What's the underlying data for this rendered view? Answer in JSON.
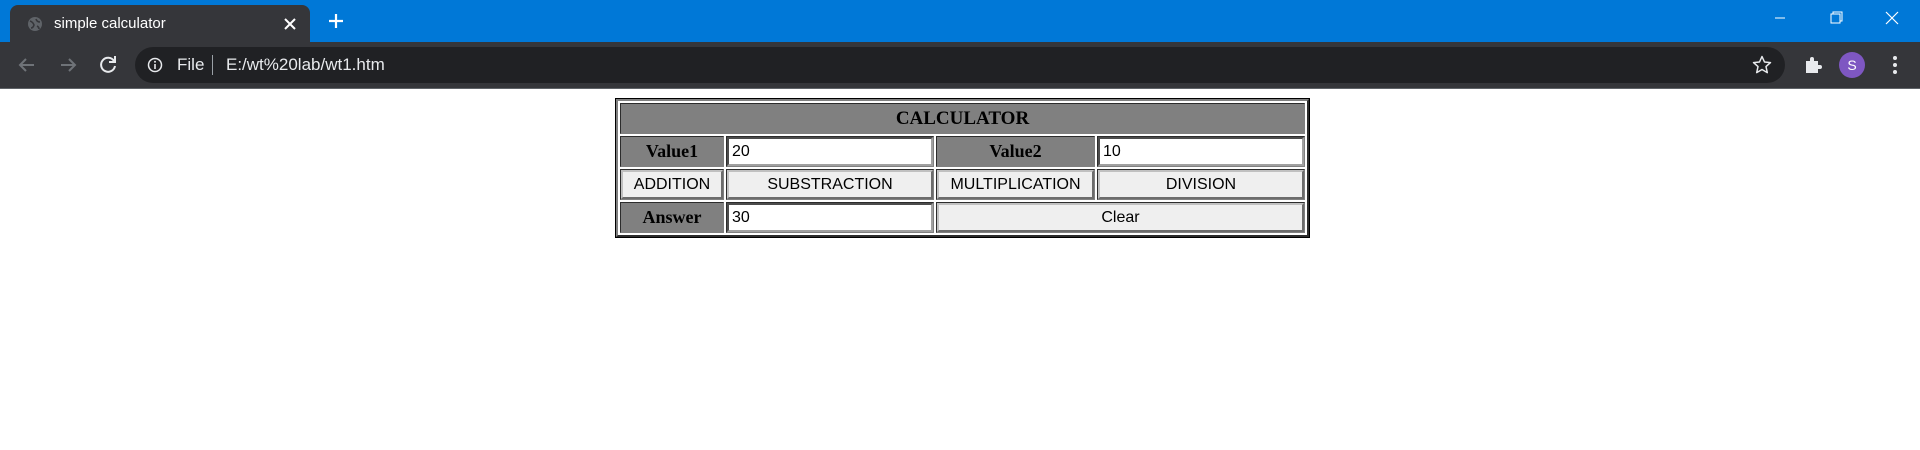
{
  "browser": {
    "tab_title": "simple calculator",
    "url_scheme": "File",
    "url": "E:/wt%20lab/wt1.htm",
    "profile_initial": "S",
    "colors": {
      "titlebar": "#0078d7",
      "toolbar": "#35363a",
      "omnibox": "#202124",
      "avatar": "#7e57c2"
    },
    "icons": [
      "globe-icon",
      "close-icon",
      "plus-icon",
      "minimize-icon",
      "restore-icon",
      "close-window-icon",
      "back-arrow-icon",
      "forward-arrow-icon",
      "reload-icon",
      "info-icon",
      "star-icon",
      "puzzle-icon",
      "kebab-menu-icon"
    ]
  },
  "calculator": {
    "heading": "CALCULATOR",
    "value1_label": "Value1",
    "value1": "20",
    "value2_label": "Value2",
    "value2": "10",
    "buttons": {
      "addition": "ADDITION",
      "subtraction": "SUBSTRACTION",
      "multiplication": "MULTIPLICATION",
      "division": "DIVISION",
      "clear": "Clear"
    },
    "answer_label": "Answer",
    "answer": "30",
    "colors": {
      "label_bg": "#808080",
      "button_bg": "#efefef"
    }
  }
}
